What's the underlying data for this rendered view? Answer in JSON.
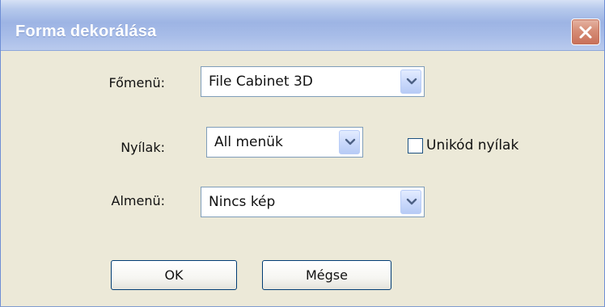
{
  "window": {
    "title": "Forma dekorálása"
  },
  "form": {
    "main_menu": {
      "label": "Főmenü:",
      "value": "File Cabinet 3D"
    },
    "arrows": {
      "label": "Nyílak:",
      "value": "All menük",
      "unicode_checkbox": {
        "label": "Unikód nyílak",
        "checked": false
      }
    },
    "submenu": {
      "label": "Almenü:",
      "value": "Nincs kép"
    }
  },
  "buttons": {
    "ok": "OK",
    "cancel": "Mégse"
  },
  "icons": {
    "close": "close-icon",
    "dropdown": "chevron-down-icon"
  },
  "colors": {
    "title_bar": "#9db4e4",
    "dialog_background": "#ece9d8",
    "close_button": "#d68d76",
    "dropdown_button": "#c9d8fb"
  }
}
